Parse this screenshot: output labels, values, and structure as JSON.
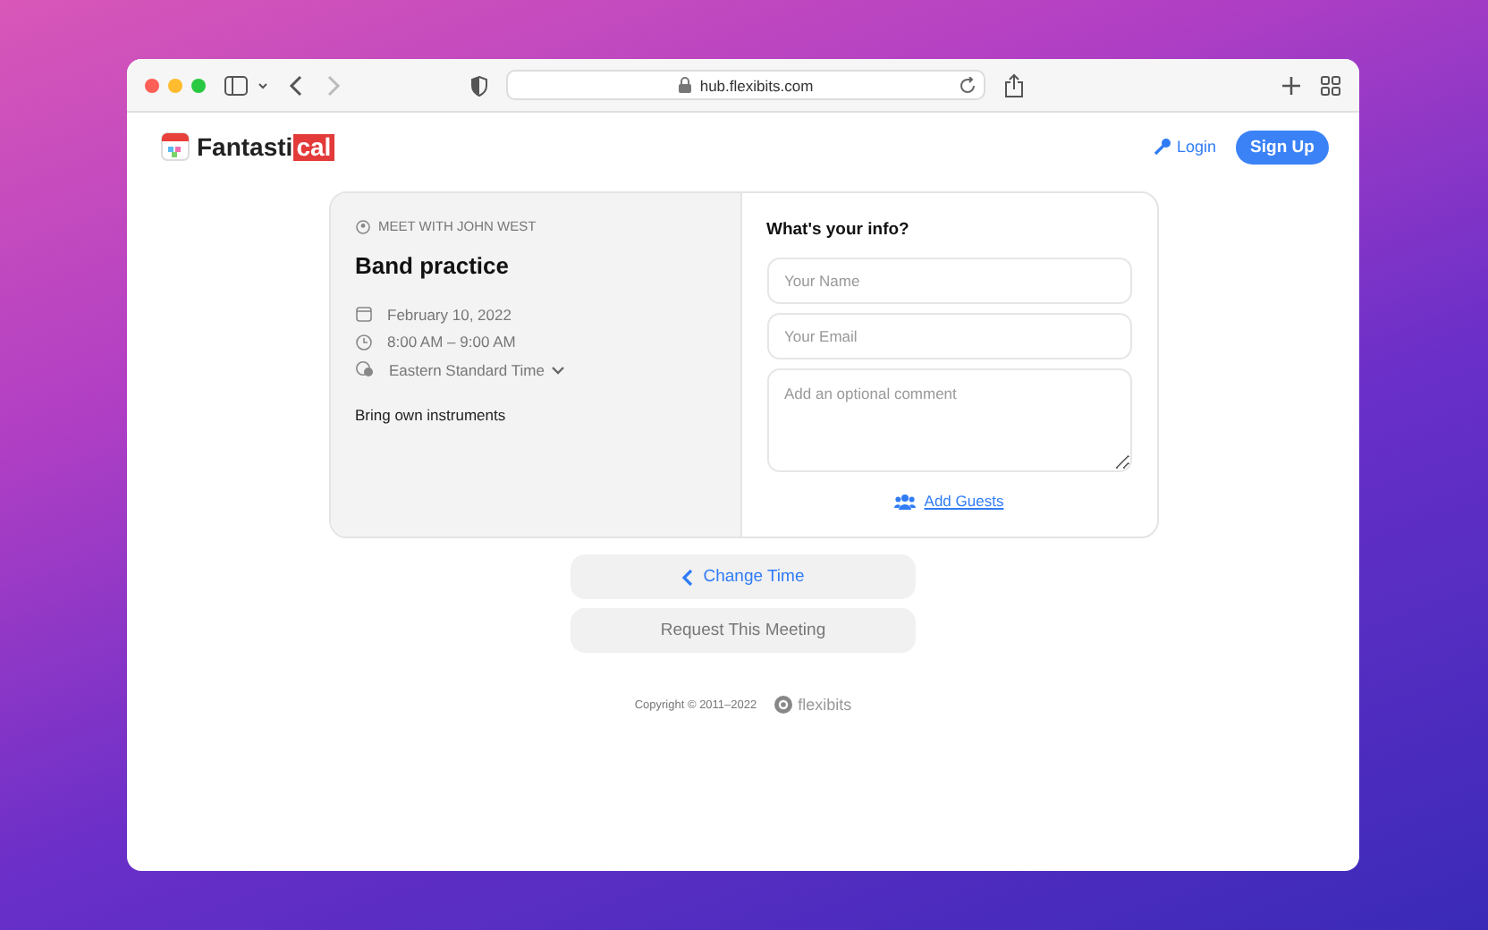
{
  "browser": {
    "url": "hub.flexibits.com"
  },
  "header": {
    "logo": {
      "main": "Fantasti",
      "accent": "cal"
    },
    "login": "Login",
    "signup": "Sign Up"
  },
  "event": {
    "organizer": "MEET WITH JOHN WEST",
    "title": "Band practice",
    "date": "February 10, 2022",
    "time": "8:00 AM – 9:00 AM",
    "timezone": "Eastern Standard Time",
    "notes": "Bring own instruments"
  },
  "form": {
    "heading": "What's your info?",
    "fields": [
      {
        "kind": "input",
        "placeholder": "Your Name"
      },
      {
        "kind": "input",
        "placeholder": "Your Email"
      },
      {
        "kind": "textarea",
        "placeholder": "Add an optional comment"
      }
    ],
    "add_guests": "Add Guests"
  },
  "actions": [
    {
      "kind": "back",
      "label": "Change Time",
      "disabled": false
    },
    {
      "kind": "submit",
      "label": "Request This Meeting",
      "disabled": true
    }
  ],
  "footer": {
    "copyright": "Copyright © 2011–2022",
    "brand": "flexibits"
  }
}
